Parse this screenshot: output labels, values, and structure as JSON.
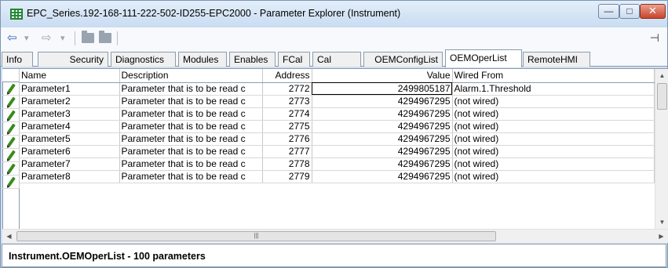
{
  "window": {
    "title": "EPC_Series.192-168-111-222-502-ID255-EPC2000 - Parameter Explorer (Instrument)",
    "icon": "grid-icon"
  },
  "toolbar": {
    "back": "⇦",
    "forward": "⇨",
    "dropdown": "▾"
  },
  "tabs": [
    {
      "label": "Info"
    },
    {
      "label": "Security"
    },
    {
      "label": "Diagnostics"
    },
    {
      "label": "Modules"
    },
    {
      "label": "Enables"
    },
    {
      "label": "FCal"
    },
    {
      "label": "Cal"
    },
    {
      "label": "OEMConfigList"
    },
    {
      "label": "OEMOperList",
      "active": true
    },
    {
      "label": "RemoteHMI"
    }
  ],
  "table": {
    "columns": {
      "name": "Name",
      "description": "Description",
      "address": "Address",
      "value": "Value",
      "wired_from": "Wired From"
    },
    "rows": [
      {
        "name": "Parameter1",
        "description": "Parameter that is to be read c",
        "address": "2772",
        "value": "2499805187",
        "wired_from": "Alarm.1.Threshold"
      },
      {
        "name": "Parameter2",
        "description": "Parameter that is to be read c",
        "address": "2773",
        "value": "4294967295",
        "wired_from": "(not wired)"
      },
      {
        "name": "Parameter3",
        "description": "Parameter that is to be read c",
        "address": "2774",
        "value": "4294967295",
        "wired_from": "(not wired)"
      },
      {
        "name": "Parameter4",
        "description": "Parameter that is to be read c",
        "address": "2775",
        "value": "4294967295",
        "wired_from": "(not wired)"
      },
      {
        "name": "Parameter5",
        "description": "Parameter that is to be read c",
        "address": "2776",
        "value": "4294967295",
        "wired_from": "(not wired)"
      },
      {
        "name": "Parameter6",
        "description": "Parameter that is to be read c",
        "address": "2777",
        "value": "4294967295",
        "wired_from": "(not wired)"
      },
      {
        "name": "Parameter7",
        "description": "Parameter that is to be read c",
        "address": "2778",
        "value": "4294967295",
        "wired_from": "(not wired)"
      },
      {
        "name": "Parameter8",
        "description": "Parameter that is to be read c",
        "address": "2779",
        "value": "4294967295",
        "wired_from": "(not wired)"
      }
    ]
  },
  "status": {
    "text": "Instrument.OEMOperList  -  100 parameters"
  },
  "colors": {
    "accent": "#2b62b8",
    "pencil": "#3a8a1e",
    "close": "#c9442b"
  }
}
